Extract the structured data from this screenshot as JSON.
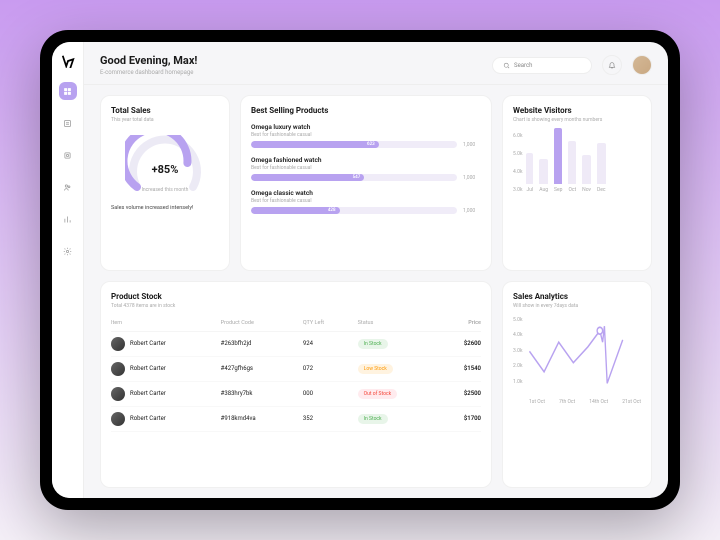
{
  "header": {
    "greeting": "Good Evening, Max!",
    "subtitle": "E-commerce dashboard homepage",
    "search_placeholder": "Search"
  },
  "sidebar": {
    "items": [
      "home",
      "orders",
      "products",
      "customers",
      "analytics",
      "settings"
    ]
  },
  "total_sales": {
    "title": "Total Sales",
    "sub": "This year total data",
    "value": "+85%",
    "label": "Increased this month",
    "note": "Sales volume increased intensely!"
  },
  "best_selling": {
    "title": "Best Selling Products",
    "items": [
      {
        "name": "Omega luxury watch",
        "sub": "Best for fashionable casual",
        "val": "623",
        "max": "1,000",
        "pct": 62
      },
      {
        "name": "Omega fashioned watch",
        "sub": "Best for fashionable casual",
        "val": "547",
        "max": "1,000",
        "pct": 55
      },
      {
        "name": "Omega classic watch",
        "sub": "Best for fashionable casual",
        "val": "428",
        "max": "1,000",
        "pct": 43
      }
    ]
  },
  "visitors": {
    "title": "Website Visitors",
    "sub": "Chart is showing every months numbers"
  },
  "stock": {
    "title": "Product Stock",
    "sub": "Total 4378 items are in stock",
    "cols": {
      "item": "Item",
      "code": "Product Code",
      "qty": "QTY Left",
      "status": "Status",
      "price": "Price"
    },
    "rows": [
      {
        "name": "Robert Carter",
        "code": "#263bfh2jd",
        "qty": "924",
        "status": "In Stock",
        "statusClass": "in",
        "price": "$2600"
      },
      {
        "name": "Robert Carter",
        "code": "#427gfh6gs",
        "qty": "072",
        "status": "Low Stock",
        "statusClass": "low",
        "price": "$1540"
      },
      {
        "name": "Robert Carter",
        "code": "#383hry7bk",
        "qty": "000",
        "status": "Out of Stock",
        "statusClass": "out",
        "price": "$2500"
      },
      {
        "name": "Robert Carter",
        "code": "#918kmd4va",
        "qty": "352",
        "status": "In Stock",
        "statusClass": "in",
        "price": "$1700"
      }
    ]
  },
  "analytics": {
    "title": "Sales Analytics",
    "sub": "Will show in every 7days data"
  },
  "chart_data": [
    {
      "type": "bar",
      "title": "Website Visitors",
      "categories": [
        "Jul",
        "Aug",
        "Sep",
        "Oct",
        "Nov",
        "Dec"
      ],
      "values": [
        3.2,
        2.6,
        5.8,
        4.4,
        3.0,
        4.2
      ],
      "highlight_index": 2,
      "ylabel": "",
      "ylim": [
        0,
        6
      ],
      "yticks": [
        "6.0k",
        "5.0k",
        "4.0k",
        "3.0k"
      ]
    },
    {
      "type": "line",
      "title": "Sales Analytics",
      "x": [
        "1st Oct",
        "7th Oct",
        "14th Oct",
        "21st Oct"
      ],
      "values": [
        3.4,
        2.2,
        4.1,
        2.6,
        3.9,
        4.8,
        1.9,
        4.3
      ],
      "ylim": [
        1,
        5
      ],
      "yticks": [
        "5.0k",
        "4.0k",
        "3.0k",
        "2.0k",
        "1.0k"
      ]
    }
  ]
}
